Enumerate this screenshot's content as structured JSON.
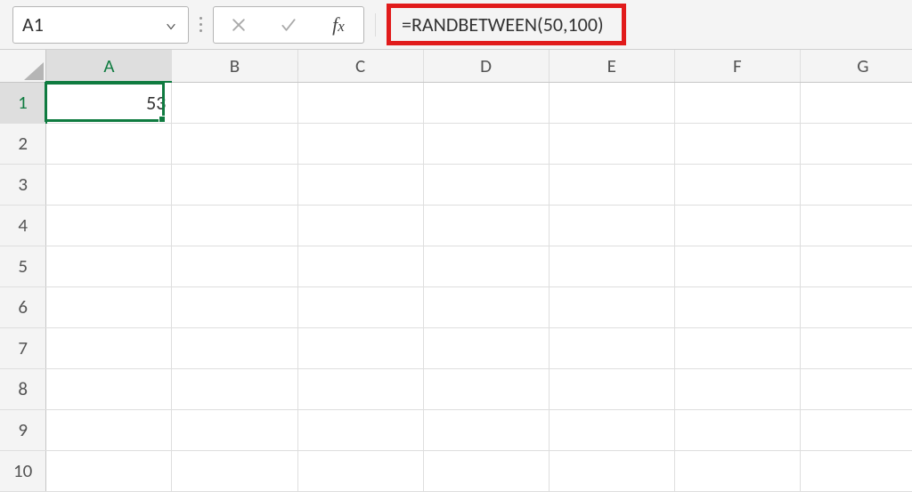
{
  "nameBox": {
    "value": "A1"
  },
  "formula": {
    "text": "=RANDBETWEEN(50,100)"
  },
  "columns": [
    "A",
    "B",
    "C",
    "D",
    "E",
    "F",
    "G"
  ],
  "rows": [
    "1",
    "2",
    "3",
    "4",
    "5",
    "6",
    "7",
    "8",
    "9",
    "10"
  ],
  "selectedColumnIndex": 0,
  "selectedRowIndex": 0,
  "cells": {
    "A1": "53"
  }
}
